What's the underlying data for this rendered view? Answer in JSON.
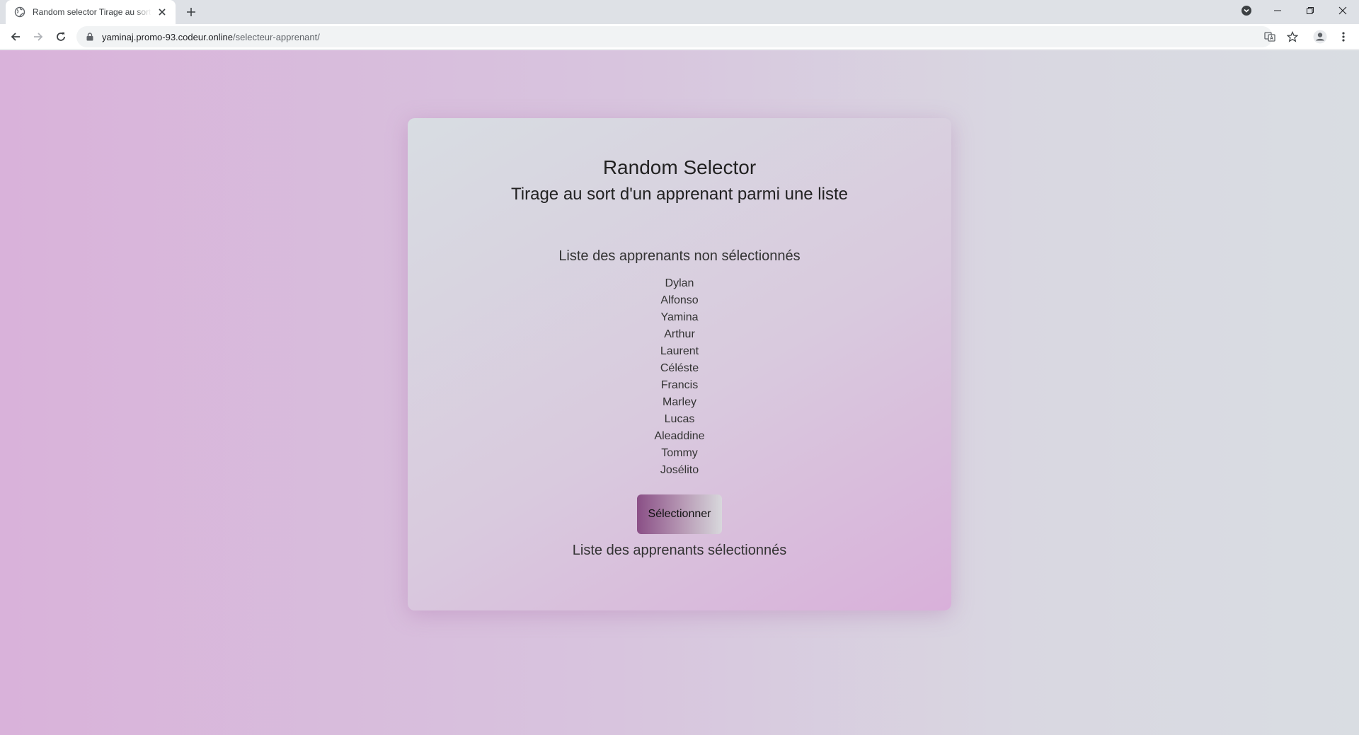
{
  "browser": {
    "tab_title": "Random selector Tirage au sort d'un apprenant parmi une liste",
    "url_host": "yaminaj.promo-93.codeur.online",
    "url_path": "/selecteur-apprenant/"
  },
  "page": {
    "title": "Random Selector",
    "subtitle": "Tirage au sort d'un apprenant parmi une liste",
    "unselected_heading": "Liste des apprenants non sélectionnés",
    "unselected_list": [
      "Dylan",
      "Alfonso",
      "Yamina",
      "Arthur",
      "Laurent",
      "Céléste",
      "Francis",
      "Marley",
      "Lucas",
      "Aleaddine",
      "Tommy",
      "Josélito"
    ],
    "select_button": "Sélectionner",
    "selected_heading": "Liste des apprenants sélectionnés"
  },
  "colors": {
    "button_gradient_start": "#8a4f86",
    "background_left": "#d9b2da",
    "background_right": "#d9dde2"
  }
}
